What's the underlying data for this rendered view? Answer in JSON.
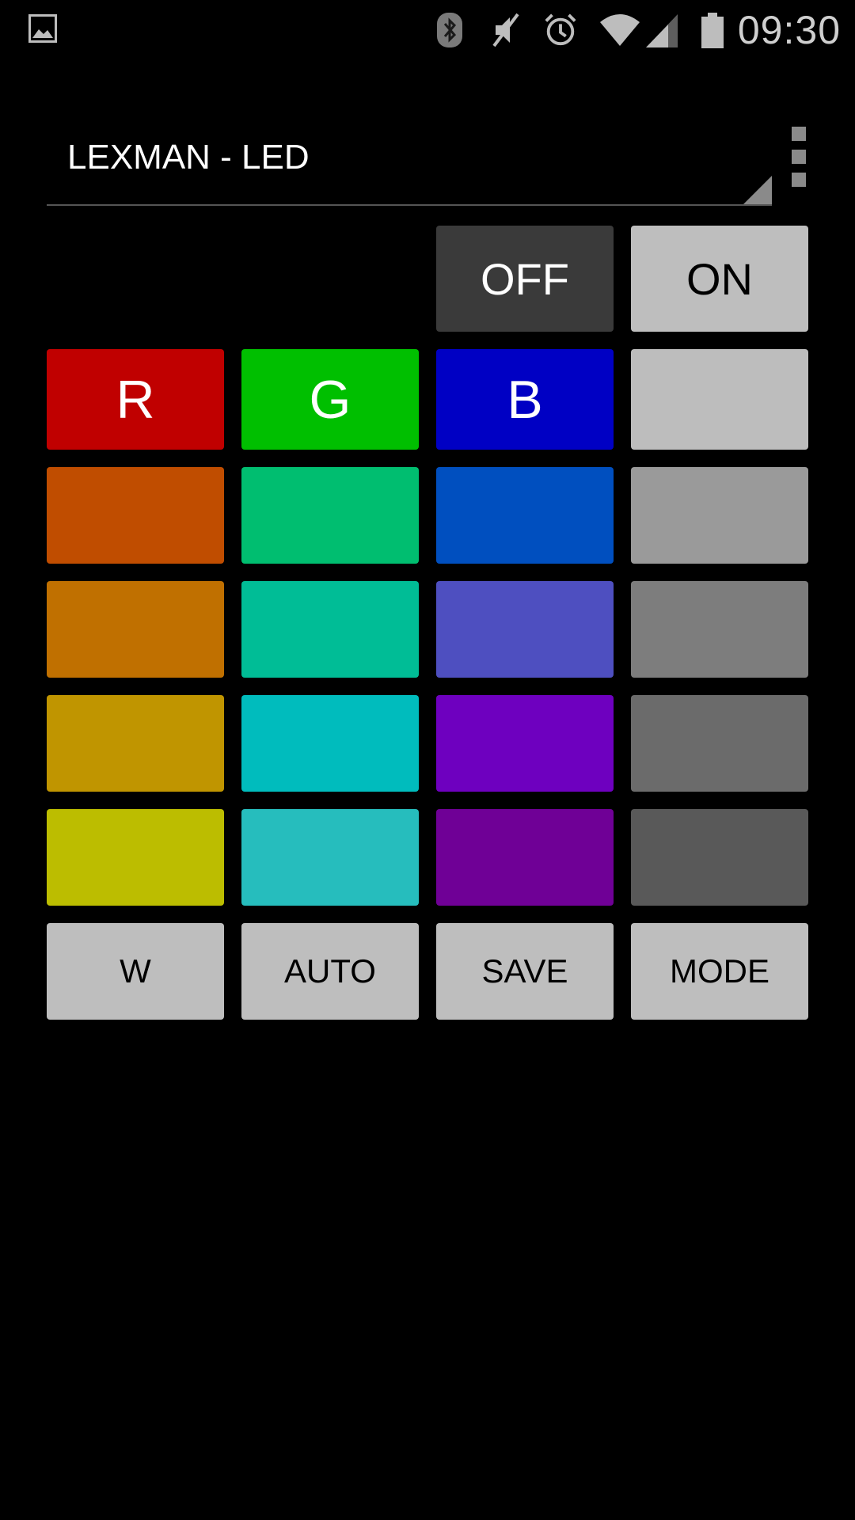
{
  "status_bar": {
    "time": "09:30",
    "icons": [
      "gallery-notification-icon",
      "bluetooth-icon",
      "mute-icon",
      "alarm-icon",
      "wifi-icon",
      "signal-icon",
      "battery-icon"
    ]
  },
  "header": {
    "spinner_label": "LEXMAN - LED",
    "overflow_icon": "overflow-menu-icon"
  },
  "controls": {
    "off_label": "OFF",
    "on_label": "ON"
  },
  "rgb_row": {
    "r_label": "R",
    "g_label": "G",
    "b_label": "B"
  },
  "colors": {
    "red": "#c00000",
    "green": "#00bf00",
    "blue": "#0000c4",
    "white_swatch": "#bdbdbd",
    "swatch_rows": [
      [
        "#c04d00",
        "#00be70",
        "#004fbf",
        "#9a9a9a"
      ],
      [
        "#c07000",
        "#00bd96",
        "#4e4fc0",
        "#7d7d7d"
      ],
      [
        "#c09500",
        "#00bcbd",
        "#6e00bf",
        "#6b6b6b"
      ],
      [
        "#bcbd00",
        "#26bdbd",
        "#6f0096",
        "#595959"
      ]
    ]
  },
  "bottom_row": {
    "w_label": "W",
    "auto_label": "AUTO",
    "save_label": "SAVE",
    "mode_label": "MODE"
  }
}
